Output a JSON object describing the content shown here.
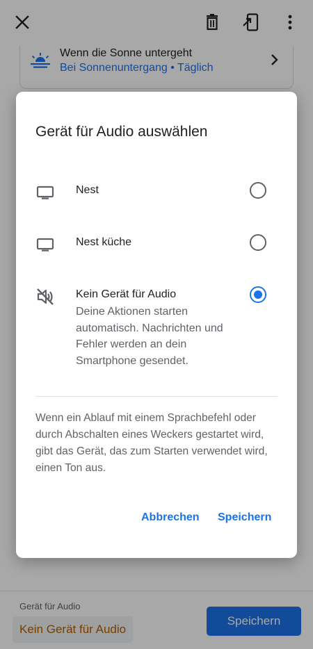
{
  "routine": {
    "trigger_title": "Wenn die Sonne untergeht",
    "trigger_subtitle": "Bei Sonnenuntergang • Täglich"
  },
  "bottom_bar": {
    "label": "Gerät für Audio",
    "value": "Kein Gerät für Audio",
    "save_label": "Speichern"
  },
  "dialog": {
    "title": "Gerät für Audio auswählen",
    "options": [
      {
        "label": "Nest",
        "icon": "tv-icon",
        "selected": false
      },
      {
        "label": "Nest küche",
        "icon": "tv-icon",
        "selected": false
      },
      {
        "label": "Kein Gerät für Audio",
        "icon": "volume-off-icon",
        "selected": true,
        "description": "Deine Aktionen starten automatisch. Nachrichten und Fehler werden an dein Smartphone gesendet."
      }
    ],
    "info": "Wenn ein Ablauf mit einem Sprachbefehl oder durch Abschalten eines Weckers gestartet wird, gibt das Gerät, das zum Starten verwendet wird, einen Ton aus.",
    "cancel_label": "Abbrechen",
    "save_label": "Speichern"
  },
  "colors": {
    "accent": "#1a73e8",
    "selected_value": "#b06000",
    "text_primary": "#202124",
    "text_secondary": "#5f6368"
  }
}
